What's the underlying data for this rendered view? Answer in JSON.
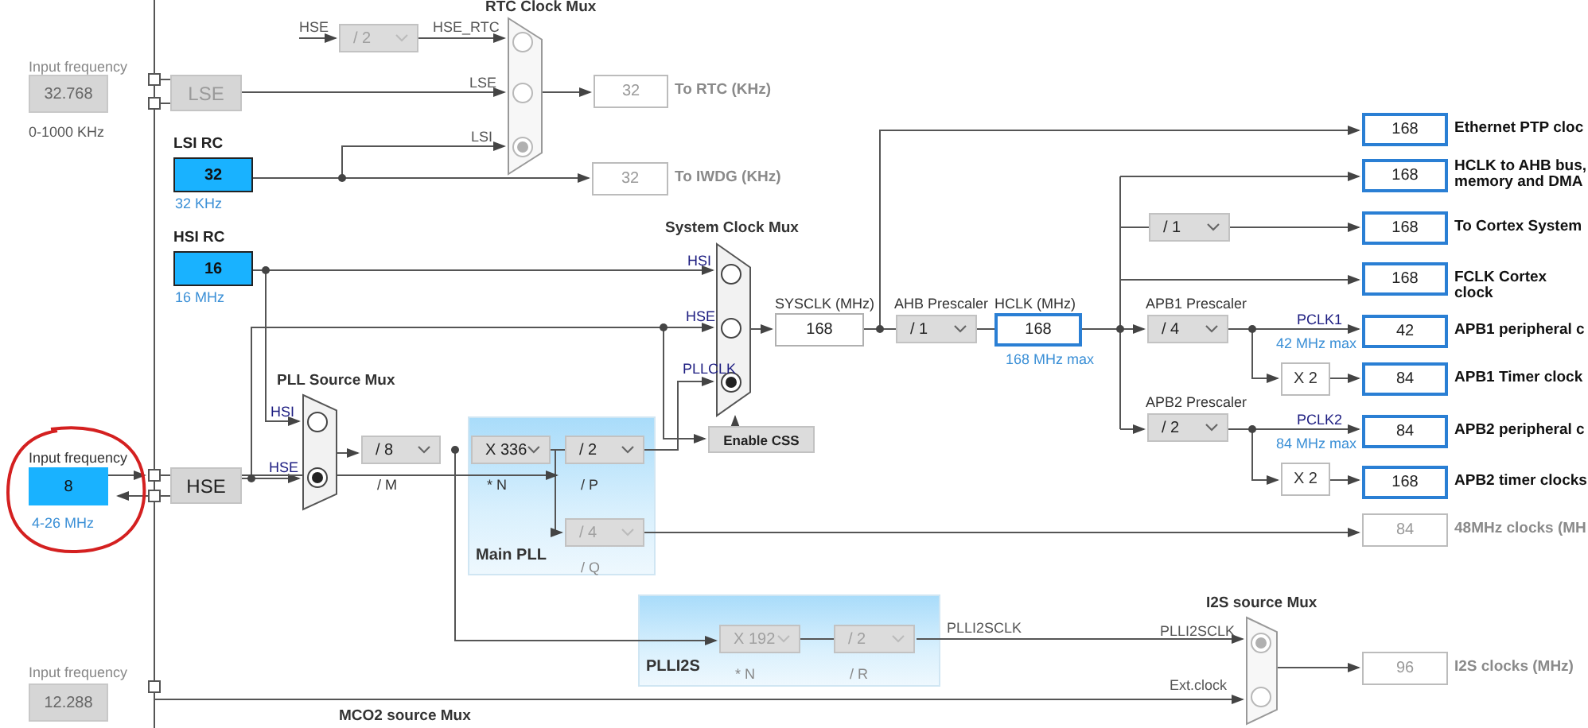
{
  "input_frequencies": [
    {
      "title": "Input frequency",
      "value": "32.768",
      "range": "0-1000 KHz",
      "enabled": false
    },
    {
      "title": "Input frequency",
      "value": "8",
      "range": "4-26 MHz",
      "enabled": true
    },
    {
      "title": "Input frequency",
      "value": "12.288",
      "enabled": false
    }
  ],
  "sources": [
    {
      "label": "LSE",
      "enabled": false
    },
    {
      "label": "HSE",
      "enabled": true
    }
  ],
  "oscillators": [
    {
      "title": "LSI RC",
      "value": "32",
      "note": "32 KHz"
    },
    {
      "title": "HSI RC",
      "value": "16",
      "note": "16 MHz"
    }
  ],
  "muxes": [
    {
      "title": "RTC Clock Mux",
      "enabled": false,
      "inputs": [
        {
          "label": "HSE_RTC",
          "selected": false
        },
        {
          "label": "LSE",
          "selected": false
        },
        {
          "label": "LSI",
          "selected": true
        }
      ]
    },
    {
      "title": "System Clock Mux",
      "enabled": true,
      "inputs": [
        {
          "label": "HSI",
          "selected": false
        },
        {
          "label": "HSE",
          "selected": false
        },
        {
          "label": "PLLCLK",
          "selected": true
        }
      ]
    },
    {
      "title": "PLL Source Mux",
      "enabled": true,
      "inputs": [
        {
          "label": "HSI",
          "selected": false
        },
        {
          "label": "HSE",
          "selected": true
        }
      ]
    },
    {
      "title": "I2S source Mux",
      "enabled": false,
      "inputs": [
        {
          "label": "PLLI2SCLK",
          "selected": true
        },
        {
          "label": "Ext.clock",
          "selected": false
        }
      ]
    }
  ],
  "wire_labels": [
    "HSE",
    "PLLI2SCLK"
  ],
  "panels": [
    {
      "title": "Main PLL"
    },
    {
      "title": "PLLI2S"
    }
  ],
  "dropdowns": [
    {
      "value": "/ 2",
      "enabled": false
    },
    {
      "value": "/ 8",
      "caption": "/ M",
      "enabled": true
    },
    {
      "value": "X 336",
      "caption": "* N",
      "enabled": true
    },
    {
      "value": "/ 2",
      "caption": "/ P",
      "enabled": true
    },
    {
      "value": "/ 4",
      "caption": "/ Q",
      "enabled": false
    },
    {
      "value": "/ 1",
      "title": "AHB Prescaler",
      "enabled": true
    },
    {
      "value": "/ 1",
      "enabled": true
    },
    {
      "value": "/ 4",
      "title": "APB1 Prescaler",
      "enabled": true
    },
    {
      "value": "/ 2",
      "title": "APB2 Prescaler",
      "enabled": true
    },
    {
      "value": "X 192",
      "caption": "* N",
      "enabled": false
    },
    {
      "value": "/ 2",
      "caption": "/ R",
      "enabled": false
    }
  ],
  "readouts": [
    {
      "title": "SYSCLK (MHz)",
      "value": "168",
      "highlighted": false
    },
    {
      "title": "HCLK (MHz)",
      "value": "168",
      "note": "168 MHz max",
      "highlighted": true
    }
  ],
  "enable_css": "Enable CSS",
  "bus_labels": [
    {
      "name": "PCLK1",
      "limit": "42 MHz max"
    },
    {
      "name": "PCLK2",
      "limit": "84 MHz max"
    }
  ],
  "multipliers": [
    "X 2",
    "X 2"
  ],
  "outputs": [
    {
      "value": "32",
      "label": "To RTC (KHz)",
      "enabled": false
    },
    {
      "value": "32",
      "label": "To IWDG (KHz)",
      "enabled": false
    },
    {
      "value": "168",
      "label": "Ethernet PTP cloc",
      "enabled": true
    },
    {
      "value": "168",
      "label": "HCLK to AHB bus,\nmemory and DMA",
      "enabled": true
    },
    {
      "value": "168",
      "label": "To Cortex System",
      "enabled": true
    },
    {
      "value": "168",
      "label": "FCLK Cortex clock",
      "enabled": true
    },
    {
      "value": "42",
      "label": "APB1 peripheral c",
      "enabled": true
    },
    {
      "value": "84",
      "label": "APB1 Timer clock",
      "enabled": true
    },
    {
      "value": "84",
      "label": "APB2 peripheral c",
      "enabled": true
    },
    {
      "value": "168",
      "label": "APB2 timer clocks",
      "enabled": true
    },
    {
      "value": "84",
      "label": "48MHz clocks (MH",
      "enabled": false
    },
    {
      "value": "96",
      "label": "I2S clocks (MHz)",
      "enabled": false
    }
  ],
  "footer_title": "MCO2 source Mux"
}
